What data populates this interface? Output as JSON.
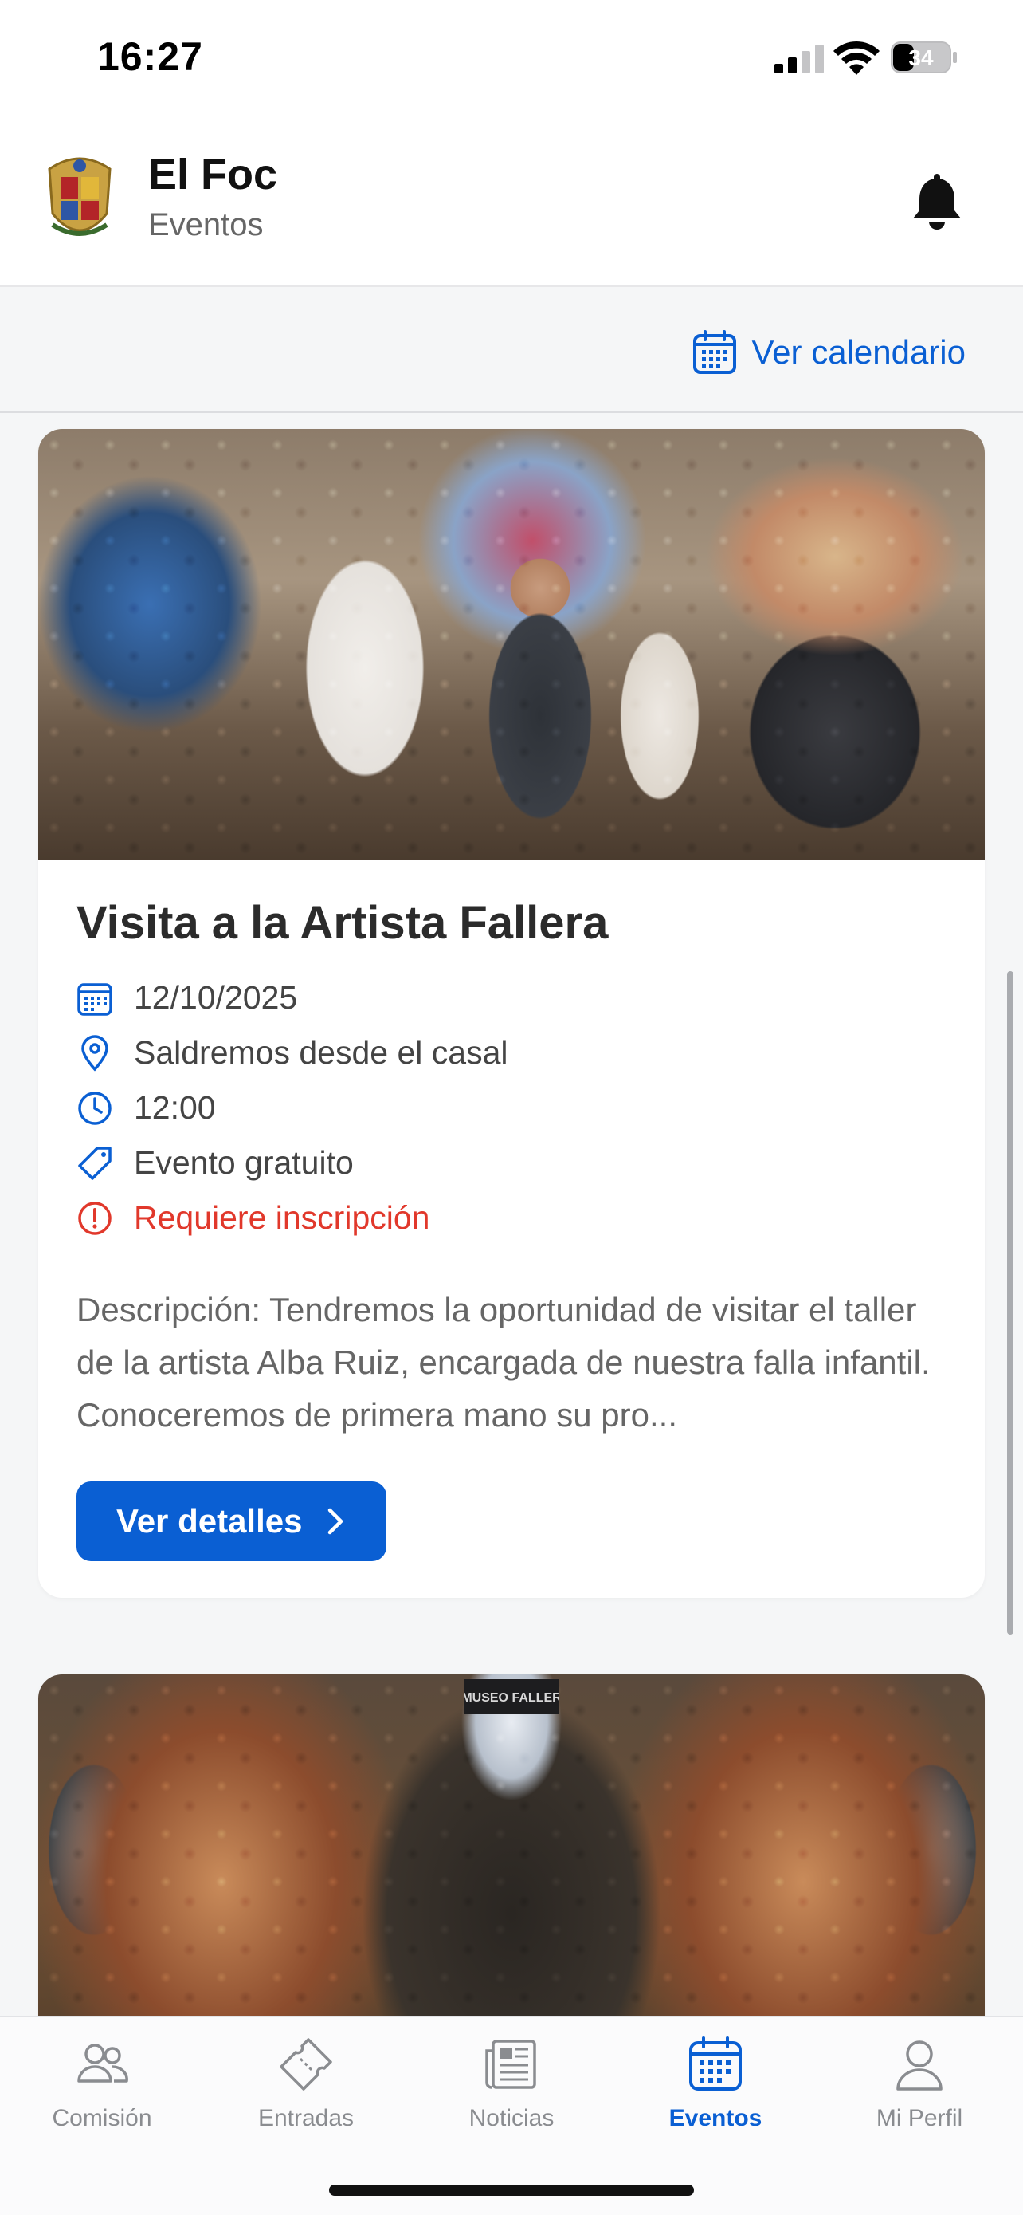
{
  "status_bar": {
    "time": "16:27",
    "battery": "34"
  },
  "header": {
    "title": "El Foc",
    "subtitle": "Eventos"
  },
  "toolbar": {
    "calendar_link": "Ver calendario"
  },
  "events": [
    {
      "title": "Visita a la Artista Fallera",
      "date": "12/10/2025",
      "location": "Saldremos desde el casal",
      "time": "12:00",
      "price": "Evento gratuito",
      "registration": "Requiere inscripción",
      "description": "Descripción: Tendremos la oportunidad de visitar el taller de la artista Alba Ruiz, encargada de nuestra falla infantil. Conoceremos de primera mano su pro...",
      "button": "Ver detalles"
    },
    {
      "image_sign": "MUSEO FALLER"
    }
  ],
  "tabs": [
    {
      "label": "Comisión",
      "icon": "people-icon"
    },
    {
      "label": "Entradas",
      "icon": "ticket-icon"
    },
    {
      "label": "Noticias",
      "icon": "newspaper-icon"
    },
    {
      "label": "Eventos",
      "icon": "calendar-icon",
      "active": true
    },
    {
      "label": "Mi Perfil",
      "icon": "person-icon"
    }
  ],
  "colors": {
    "accent": "#0a5fd3",
    "warning": "#e1382b"
  }
}
